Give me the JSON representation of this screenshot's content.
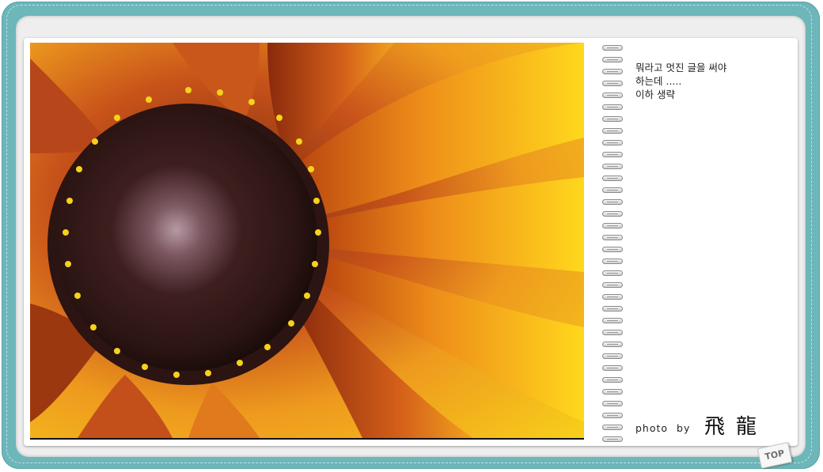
{
  "note": {
    "lines": [
      "뭐라고 멋진 글을 써야",
      "하는데 .....",
      "이하 생략"
    ]
  },
  "credit": {
    "label": "photo by",
    "name": "飛龍"
  },
  "top_button": {
    "label": "TOP"
  },
  "colors": {
    "frame": "#6db6b9",
    "frame_inner": "#eeeeee",
    "card": "#ffffff",
    "petal_yellow": "#f5c21a",
    "petal_orange": "#d9661c",
    "flower_center": "#3b1d1a"
  },
  "icons": {
    "binding": "spiral-binding-icon"
  }
}
